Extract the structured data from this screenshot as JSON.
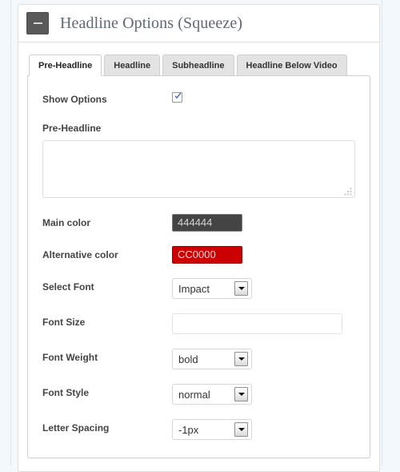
{
  "panel": {
    "title": "Headline Options (Squeeze)",
    "collapse_icon": "minus-icon",
    "collapse_label": "-"
  },
  "tabs": [
    {
      "label": "Pre-Headline",
      "active": true
    },
    {
      "label": "Headline",
      "active": false
    },
    {
      "label": "Subheadline",
      "active": false
    },
    {
      "label": "Headline Below Video",
      "active": false
    }
  ],
  "form": {
    "show_options": {
      "label": "Show Options",
      "checked": true
    },
    "pre_headline": {
      "label": "Pre-Headline",
      "value": "",
      "placeholder": ""
    },
    "main_color": {
      "label": "Main color",
      "value": "444444",
      "swatch": "#444444",
      "text_color": "#d4d4d4"
    },
    "alternative_color": {
      "label": "Alternative color",
      "value": "CC0000",
      "swatch": "#CC0000",
      "text_color": "#f3d6d6"
    },
    "select_font": {
      "label": "Select Font",
      "value": "Impact"
    },
    "font_size": {
      "label": "Font Size",
      "value": "",
      "placeholder": ""
    },
    "font_weight": {
      "label": "Font Weight",
      "value": "bold"
    },
    "font_style": {
      "label": "Font Style",
      "value": "normal"
    },
    "letter_spacing": {
      "label": "Letter Spacing",
      "value": "-1px"
    }
  },
  "colors": {
    "page_background": "#f2f8fc",
    "panel_background": "#ffffff",
    "panel_border": "#dfdfdf",
    "tab_inactive": "#e3e3e3",
    "tab_border": "#cfcfcf",
    "title_text": "#5d6a72",
    "label_text": "#444444",
    "collapse_button": "#595959",
    "checkbox_tick": "#3c6eb4"
  }
}
